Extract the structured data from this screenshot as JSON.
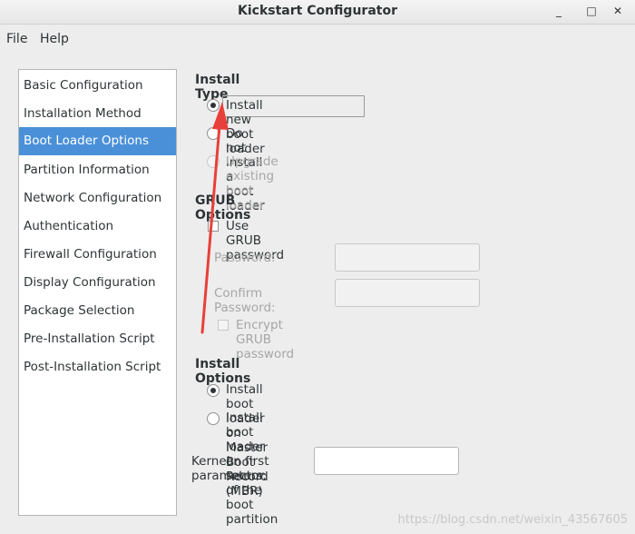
{
  "window": {
    "title": "Kickstart Configurator",
    "minimize_glyph": "_",
    "maximize_glyph": "□",
    "close_glyph": "✕"
  },
  "menubar": {
    "file": "File",
    "help": "Help"
  },
  "sidebar": {
    "items": [
      {
        "label": "Basic Configuration"
      },
      {
        "label": "Installation Method"
      },
      {
        "label": "Boot Loader Options",
        "selected": true
      },
      {
        "label": "Partition Information"
      },
      {
        "label": "Network Configuration"
      },
      {
        "label": "Authentication"
      },
      {
        "label": "Firewall Configuration"
      },
      {
        "label": "Display Configuration"
      },
      {
        "label": "Package Selection"
      },
      {
        "label": "Pre-Installation Script"
      },
      {
        "label": "Post-Installation Script"
      }
    ]
  },
  "install_type": {
    "heading": "Install Type",
    "new": "Install new boot loader",
    "none": "Do not install a boot loader",
    "upgrade": "Upgrade existing boot loader",
    "selected": "new"
  },
  "grub": {
    "heading": "GRUB Options",
    "use_password": "Use GRUB password",
    "password_label": "Password:",
    "password_value": "",
    "confirm_label": "Confirm Password:",
    "confirm_value": "",
    "encrypt": "Encrypt GRUB password"
  },
  "install_options": {
    "heading": "Install Options",
    "mbr": "Install boot loader on Master Boot Record (MBR)",
    "first_sector": "Install boot loader on first sector of the boot partition",
    "selected": "mbr"
  },
  "kernel": {
    "label": "Kernel parameters:",
    "value": ""
  },
  "annotation": {
    "arrow_color": "#e8403a"
  },
  "watermark": "https://blog.csdn.net/weixin_43567605"
}
